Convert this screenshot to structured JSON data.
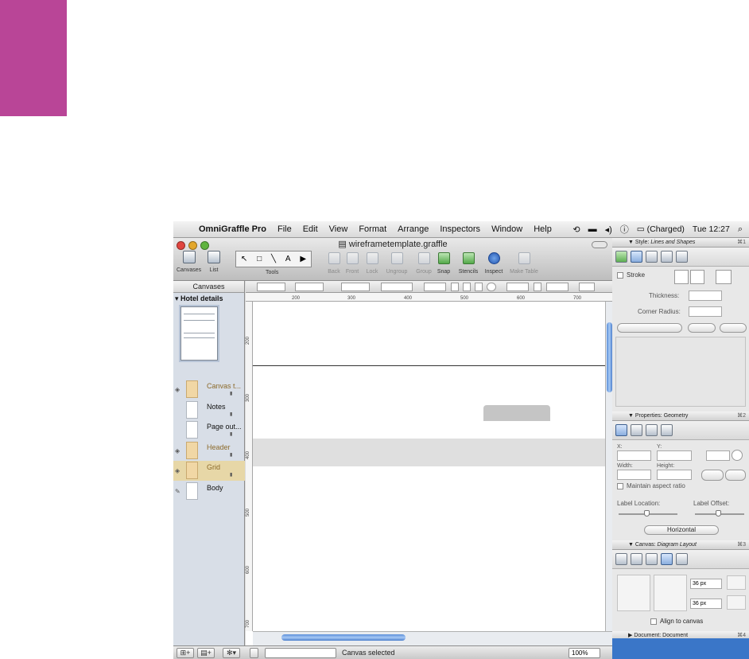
{
  "menubar": {
    "app_name": "OmniGraffle Pro",
    "items": [
      "File",
      "Edit",
      "View",
      "Format",
      "Arrange",
      "Inspectors",
      "Window",
      "Help"
    ],
    "battery_status": "(Charged)",
    "clock": "Tue 12:27"
  },
  "window": {
    "title": "wireframetemplate.graffle",
    "toolbar": {
      "canvases_label": "Canvases",
      "list_label": "List",
      "tools_label": "Tools",
      "back_label": "Back",
      "front_label": "Front",
      "lock_label": "Lock",
      "ungroup_label": "Ungroup",
      "group_label": "Group",
      "snap_label": "Snap",
      "stencils_label": "Stencils",
      "inspect_label": "Inspect",
      "make_table_label": "Make Table"
    }
  },
  "sidebar": {
    "header": "Canvases",
    "document": "Hotel details",
    "layers": [
      {
        "name": "Canvas t..."
      },
      {
        "name": "Notes"
      },
      {
        "name": "Page out..."
      },
      {
        "name": "Header"
      },
      {
        "name": "Grid"
      },
      {
        "name": "Body"
      }
    ]
  },
  "ruler": {
    "h_ticks": [
      "200",
      "300",
      "400",
      "500",
      "600",
      "700"
    ],
    "v_ticks": [
      "200",
      "300",
      "400",
      "500",
      "600",
      "700"
    ]
  },
  "statusbar": {
    "status": "Canvas selected",
    "zoom": "100%"
  },
  "inspector": {
    "style": {
      "title": "Style:",
      "subtitle": "Lines and Shapes",
      "shortcut": "⌘1",
      "stroke_label": "Stroke",
      "thickness_label": "Thickness:",
      "corner_radius_label": "Corner Radius:"
    },
    "properties": {
      "title": "Properties:",
      "subtitle": "Geometry",
      "shortcut": "⌘2",
      "x_label": "X:",
      "y_label": "Y:",
      "width_label": "Width:",
      "height_label": "Height:",
      "aspect_label": "Maintain aspect ratio",
      "label_location": "Label Location:",
      "label_offset": "Label Offset:",
      "orientation": "Horizontal"
    },
    "canvas": {
      "title": "Canvas:",
      "subtitle": "Diagram Layout",
      "shortcut": "⌘3",
      "spacing_1": "36 px",
      "spacing_2": "36 px",
      "align_label": "Align to canvas"
    },
    "document": {
      "title": "Document:",
      "subtitle": "Document",
      "shortcut": "⌘4"
    }
  }
}
